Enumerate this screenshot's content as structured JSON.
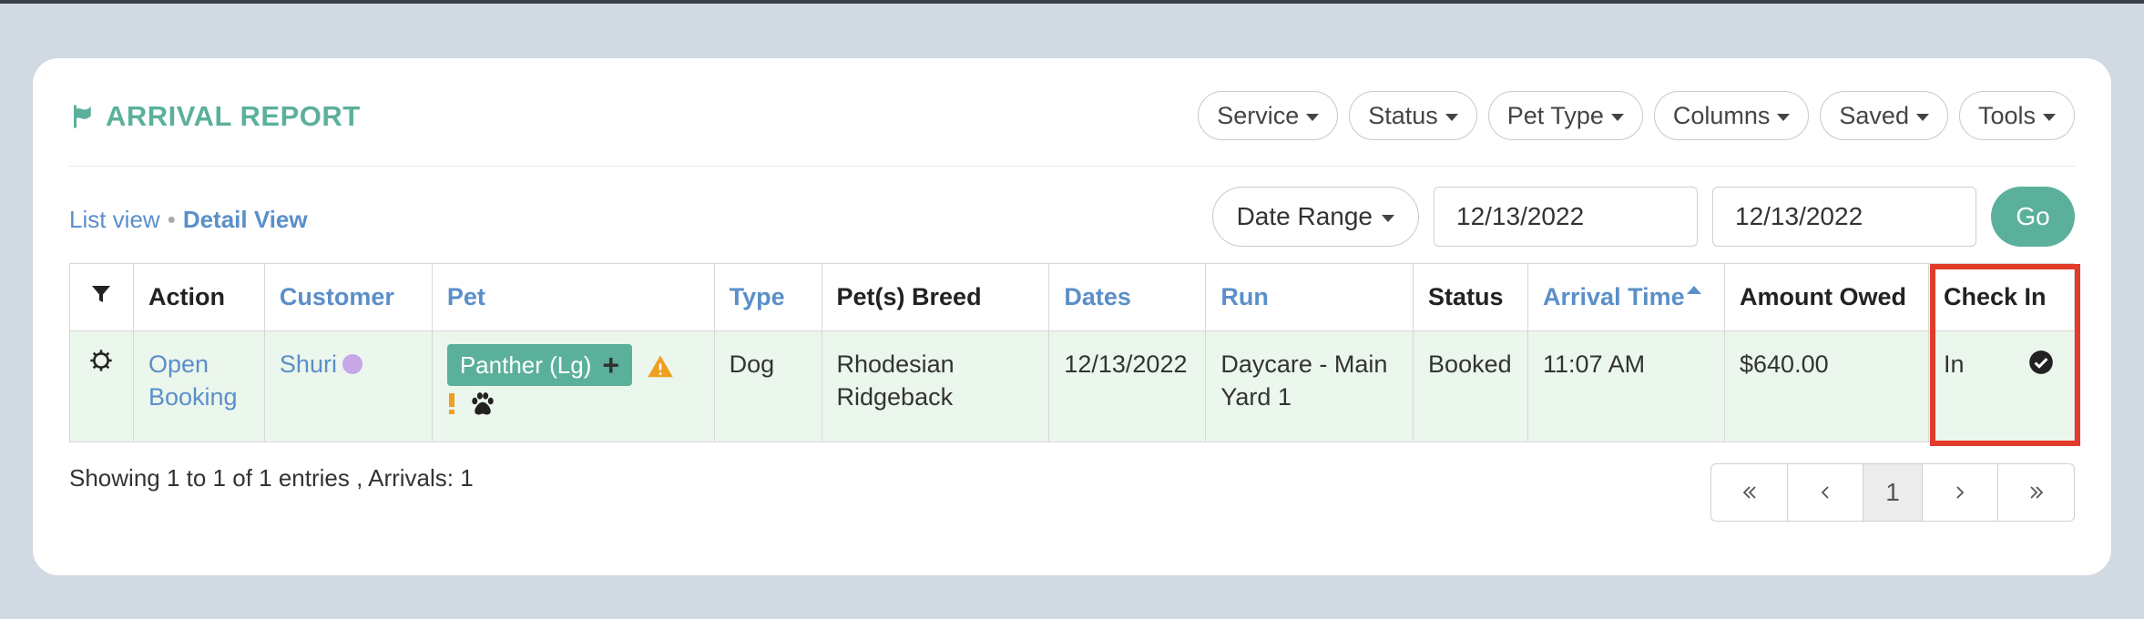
{
  "report": {
    "title": "ARRIVAL REPORT",
    "filters": [
      {
        "label": "Service"
      },
      {
        "label": "Status"
      },
      {
        "label": "Pet Type"
      },
      {
        "label": "Columns"
      },
      {
        "label": "Saved"
      },
      {
        "label": "Tools"
      }
    ]
  },
  "views": {
    "list": "List view",
    "separator": "•",
    "detail": "Detail View"
  },
  "dates": {
    "range_label": "Date Range",
    "start": "12/13/2022",
    "end": "12/13/2022",
    "go": "Go"
  },
  "table": {
    "headers": {
      "action": "Action",
      "customer": "Customer",
      "pet": "Pet",
      "type": "Type",
      "breed": "Pet(s) Breed",
      "dates": "Dates",
      "run": "Run",
      "status": "Status",
      "arrival": "Arrival Time",
      "owed": "Amount Owed",
      "checkin": "Check In"
    },
    "row": {
      "action": "Open Booking",
      "customer": "Shuri",
      "pet": "Panther (Lg)",
      "type": "Dog",
      "breed": "Rhodesian Ridgeback",
      "dates": "12/13/2022",
      "run": "Daycare - Main Yard 1",
      "status": "Booked",
      "arrival": "11:07 AM",
      "owed": "$640.00",
      "checkin": "In"
    }
  },
  "footer": {
    "entries": "Showing 1 to 1 of 1 entries , Arrivals: 1",
    "current_page": "1"
  },
  "colors": {
    "accent": "#5bb09b",
    "link": "#5a8fc9",
    "row_bg": "#ebf6ec",
    "highlight": "#e23b2a",
    "warning": "#f0a020"
  },
  "icons": [
    "flag-icon",
    "filter-icon",
    "gear-icon",
    "plus-icon",
    "warning-icon",
    "exclamation-icon",
    "paw-icon",
    "check-circle-icon",
    "double-chevron-left-icon",
    "chevron-left-icon",
    "chevron-right-icon",
    "double-chevron-right-icon"
  ]
}
